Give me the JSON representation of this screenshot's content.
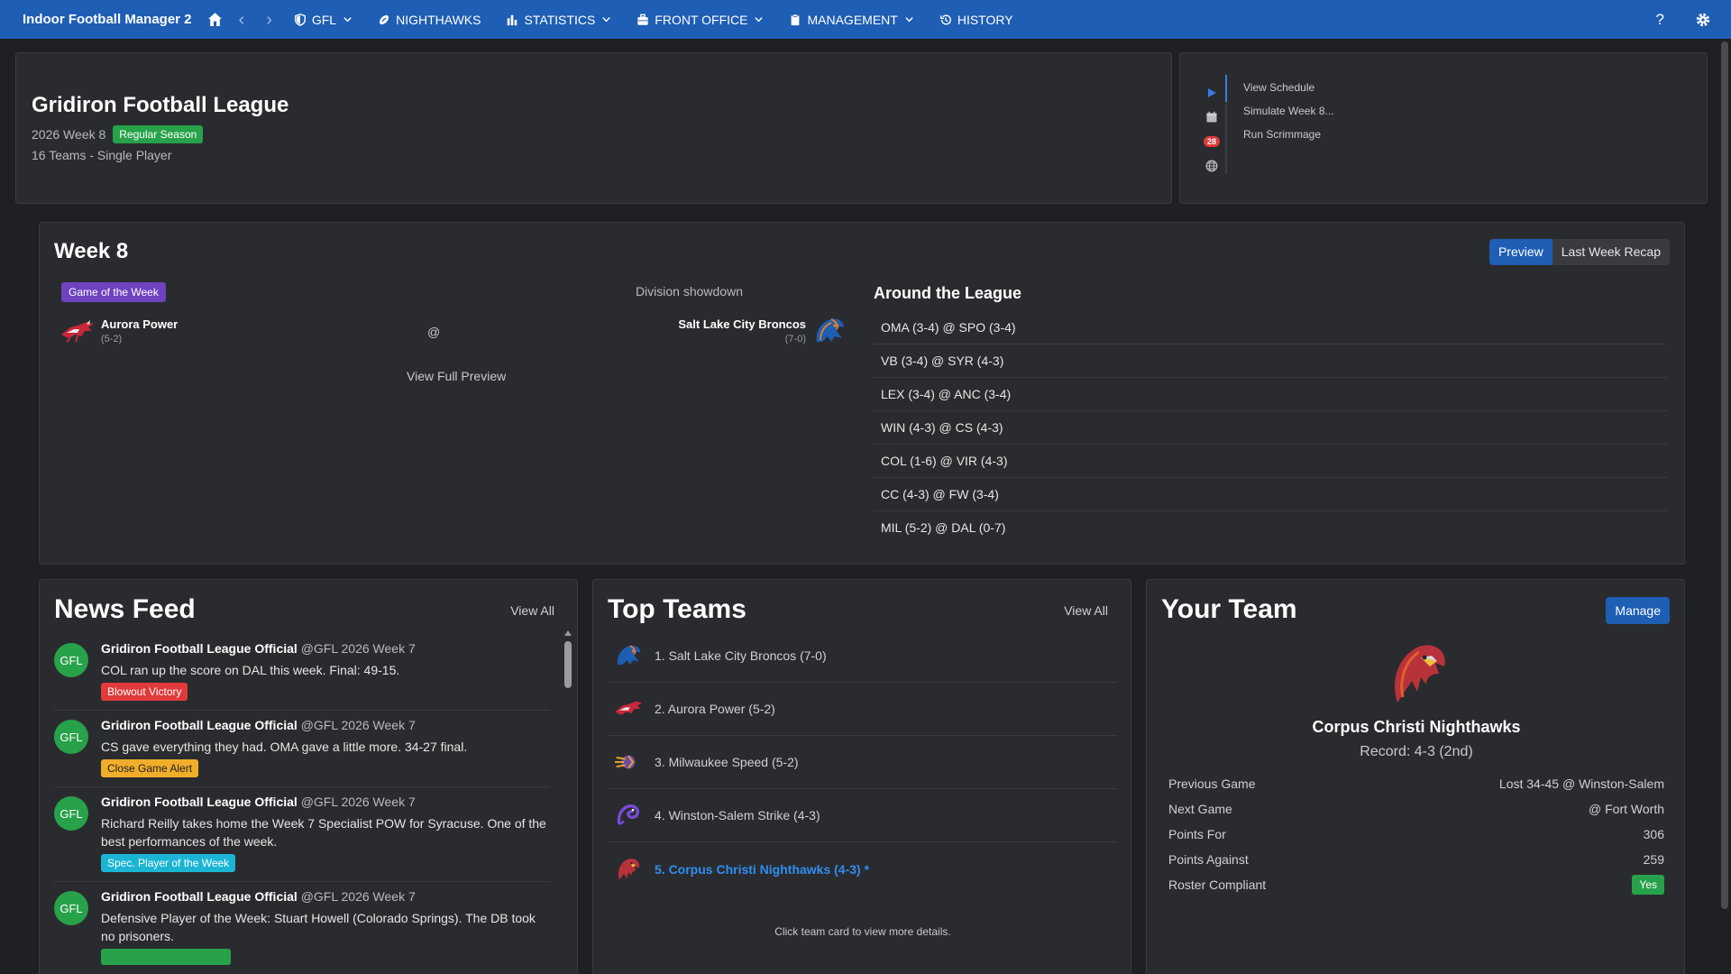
{
  "nav": {
    "brand": "Indoor Football Manager 2",
    "items": [
      {
        "label": "GFL",
        "icon": "shield-icon",
        "dropdown": true
      },
      {
        "label": "NIGHTHAWKS",
        "icon": "football-icon",
        "dropdown": false
      },
      {
        "label": "STATISTICS",
        "icon": "bar-chart-icon",
        "dropdown": true
      },
      {
        "label": "FRONT OFFICE",
        "icon": "briefcase-icon",
        "dropdown": true
      },
      {
        "label": "MANAGEMENT",
        "icon": "clipboard-icon",
        "dropdown": true
      },
      {
        "label": "HISTORY",
        "icon": "history-icon",
        "dropdown": false
      }
    ],
    "help": "?"
  },
  "league": {
    "title": "Gridiron Football League",
    "week": "2026 Week 8",
    "phase": "Regular Season",
    "teams": "16 Teams - Single Player"
  },
  "quick_actions": {
    "badge": "28",
    "links": [
      "View Schedule",
      "Simulate Week 8...",
      "Run Scrimmage"
    ]
  },
  "week": {
    "title": "Week 8",
    "tabs": {
      "preview": "Preview",
      "recap": "Last Week Recap"
    },
    "gotw_label": "Game of the Week",
    "division": "Division showdown",
    "home": {
      "name": "Aurora Power",
      "record": "(5-2)"
    },
    "at": "@",
    "away": {
      "name": "Salt Lake City Broncos",
      "record": "(7-0)"
    },
    "full_preview": "View Full Preview",
    "around_title": "Around the League",
    "around": [
      "OMA (3-4) @ SPO (3-4)",
      "VB (3-4) @ SYR (4-3)",
      "LEX (3-4) @ ANC (3-4)",
      "WIN (4-3) @ CS (4-3)",
      "COL (1-6) @ VIR (4-3)",
      "CC (4-3) @ FW (3-4)",
      "MIL (5-2) @ DAL (0-7)"
    ]
  },
  "news": {
    "title": "News Feed",
    "view_all": "View All",
    "items": [
      {
        "avatar": "GFL",
        "author": "Gridiron Football League Official",
        "meta": "@GFL 2026 Week 7",
        "body": "COL ran up the score on DAL this week. Final: 49-15.",
        "tag": "Blowout Victory",
        "tag_color": "#e03a3a"
      },
      {
        "avatar": "GFL",
        "author": "Gridiron Football League Official",
        "meta": "@GFL 2026 Week 7",
        "body": "CS gave everything they had. OMA gave a little more. 34-27 final.",
        "tag": "Close Game Alert",
        "tag_color": "#f0ad2a"
      },
      {
        "avatar": "GFL",
        "author": "Gridiron Football League Official",
        "meta": "@GFL 2026 Week 7",
        "body": "Richard Reilly takes home the Week 7 Specialist POW for Syracuse. One of the best performances of the week.",
        "tag": "Spec. Player of the Week",
        "tag_color": "#1bb5d4"
      },
      {
        "avatar": "GFL",
        "author": "Gridiron Football League Official",
        "meta": "@GFL 2026 Week 7",
        "body": "Defensive Player of the Week: Stuart Howell (Colorado Springs). The DB took no prisoners.",
        "tag": "",
        "tag_color": "#27a24a"
      }
    ]
  },
  "top_teams": {
    "title": "Top Teams",
    "view_all": "View All",
    "items": [
      "1. Salt Lake City Broncos (7-0)",
      "2. Aurora Power (5-2)",
      "3. Milwaukee Speed (5-2)",
      "4. Winston-Salem Strike (4-3)",
      "5. Corpus Christi Nighthawks (4-3) *"
    ],
    "note": "Click team card to view more details."
  },
  "your_team": {
    "title": "Your Team",
    "manage": "Manage",
    "name": "Corpus Christi Nighthawks",
    "record": "Record: 4-3 (2nd)",
    "stats": [
      {
        "label": "Previous Game",
        "value": "Lost 34-45 @ Winston-Salem"
      },
      {
        "label": "Next Game",
        "value": "@ Fort Worth"
      },
      {
        "label": "Points For",
        "value": "306"
      },
      {
        "label": "Points Against",
        "value": "259"
      }
    ],
    "roster_label": "Roster Compliant",
    "roster_value": "Yes"
  },
  "colors": {
    "nav_bg": "#1e5eb4",
    "page_bg": "#1f2023",
    "card_bg": "#2a2b2f",
    "accent_blue": "#2f8ef0",
    "purple": "#6f42c1",
    "green": "#27a24a"
  }
}
